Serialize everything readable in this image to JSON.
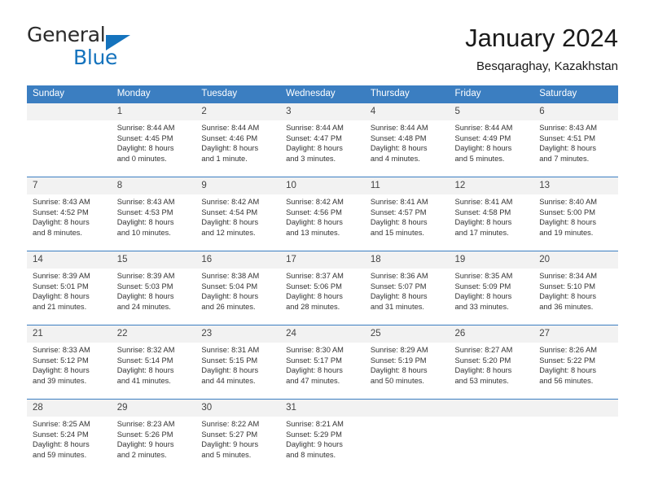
{
  "brand": {
    "name_part1": "General",
    "name_part2": "Blue"
  },
  "header": {
    "title": "January 2024",
    "location": "Besqaraghay, Kazakhstan"
  },
  "calendar": {
    "weekday_headers": [
      "Sunday",
      "Monday",
      "Tuesday",
      "Wednesday",
      "Thursday",
      "Friday",
      "Saturday"
    ],
    "colors": {
      "header_blue": "#3b7ec1",
      "daynum_band": "#f2f2f2",
      "brand_blue": "#1573bd"
    },
    "weeks": [
      [
        {
          "day": "",
          "sunrise": "",
          "sunset": "",
          "daylight_line1": "",
          "daylight_line2": ""
        },
        {
          "day": "1",
          "sunrise": "Sunrise: 8:44 AM",
          "sunset": "Sunset: 4:45 PM",
          "daylight_line1": "Daylight: 8 hours",
          "daylight_line2": "and 0 minutes."
        },
        {
          "day": "2",
          "sunrise": "Sunrise: 8:44 AM",
          "sunset": "Sunset: 4:46 PM",
          "daylight_line1": "Daylight: 8 hours",
          "daylight_line2": "and 1 minute."
        },
        {
          "day": "3",
          "sunrise": "Sunrise: 8:44 AM",
          "sunset": "Sunset: 4:47 PM",
          "daylight_line1": "Daylight: 8 hours",
          "daylight_line2": "and 3 minutes."
        },
        {
          "day": "4",
          "sunrise": "Sunrise: 8:44 AM",
          "sunset": "Sunset: 4:48 PM",
          "daylight_line1": "Daylight: 8 hours",
          "daylight_line2": "and 4 minutes."
        },
        {
          "day": "5",
          "sunrise": "Sunrise: 8:44 AM",
          "sunset": "Sunset: 4:49 PM",
          "daylight_line1": "Daylight: 8 hours",
          "daylight_line2": "and 5 minutes."
        },
        {
          "day": "6",
          "sunrise": "Sunrise: 8:43 AM",
          "sunset": "Sunset: 4:51 PM",
          "daylight_line1": "Daylight: 8 hours",
          "daylight_line2": "and 7 minutes."
        }
      ],
      [
        {
          "day": "7",
          "sunrise": "Sunrise: 8:43 AM",
          "sunset": "Sunset: 4:52 PM",
          "daylight_line1": "Daylight: 8 hours",
          "daylight_line2": "and 8 minutes."
        },
        {
          "day": "8",
          "sunrise": "Sunrise: 8:43 AM",
          "sunset": "Sunset: 4:53 PM",
          "daylight_line1": "Daylight: 8 hours",
          "daylight_line2": "and 10 minutes."
        },
        {
          "day": "9",
          "sunrise": "Sunrise: 8:42 AM",
          "sunset": "Sunset: 4:54 PM",
          "daylight_line1": "Daylight: 8 hours",
          "daylight_line2": "and 12 minutes."
        },
        {
          "day": "10",
          "sunrise": "Sunrise: 8:42 AM",
          "sunset": "Sunset: 4:56 PM",
          "daylight_line1": "Daylight: 8 hours",
          "daylight_line2": "and 13 minutes."
        },
        {
          "day": "11",
          "sunrise": "Sunrise: 8:41 AM",
          "sunset": "Sunset: 4:57 PM",
          "daylight_line1": "Daylight: 8 hours",
          "daylight_line2": "and 15 minutes."
        },
        {
          "day": "12",
          "sunrise": "Sunrise: 8:41 AM",
          "sunset": "Sunset: 4:58 PM",
          "daylight_line1": "Daylight: 8 hours",
          "daylight_line2": "and 17 minutes."
        },
        {
          "day": "13",
          "sunrise": "Sunrise: 8:40 AM",
          "sunset": "Sunset: 5:00 PM",
          "daylight_line1": "Daylight: 8 hours",
          "daylight_line2": "and 19 minutes."
        }
      ],
      [
        {
          "day": "14",
          "sunrise": "Sunrise: 8:39 AM",
          "sunset": "Sunset: 5:01 PM",
          "daylight_line1": "Daylight: 8 hours",
          "daylight_line2": "and 21 minutes."
        },
        {
          "day": "15",
          "sunrise": "Sunrise: 8:39 AM",
          "sunset": "Sunset: 5:03 PM",
          "daylight_line1": "Daylight: 8 hours",
          "daylight_line2": "and 24 minutes."
        },
        {
          "day": "16",
          "sunrise": "Sunrise: 8:38 AM",
          "sunset": "Sunset: 5:04 PM",
          "daylight_line1": "Daylight: 8 hours",
          "daylight_line2": "and 26 minutes."
        },
        {
          "day": "17",
          "sunrise": "Sunrise: 8:37 AM",
          "sunset": "Sunset: 5:06 PM",
          "daylight_line1": "Daylight: 8 hours",
          "daylight_line2": "and 28 minutes."
        },
        {
          "day": "18",
          "sunrise": "Sunrise: 8:36 AM",
          "sunset": "Sunset: 5:07 PM",
          "daylight_line1": "Daylight: 8 hours",
          "daylight_line2": "and 31 minutes."
        },
        {
          "day": "19",
          "sunrise": "Sunrise: 8:35 AM",
          "sunset": "Sunset: 5:09 PM",
          "daylight_line1": "Daylight: 8 hours",
          "daylight_line2": "and 33 minutes."
        },
        {
          "day": "20",
          "sunrise": "Sunrise: 8:34 AM",
          "sunset": "Sunset: 5:10 PM",
          "daylight_line1": "Daylight: 8 hours",
          "daylight_line2": "and 36 minutes."
        }
      ],
      [
        {
          "day": "21",
          "sunrise": "Sunrise: 8:33 AM",
          "sunset": "Sunset: 5:12 PM",
          "daylight_line1": "Daylight: 8 hours",
          "daylight_line2": "and 39 minutes."
        },
        {
          "day": "22",
          "sunrise": "Sunrise: 8:32 AM",
          "sunset": "Sunset: 5:14 PM",
          "daylight_line1": "Daylight: 8 hours",
          "daylight_line2": "and 41 minutes."
        },
        {
          "day": "23",
          "sunrise": "Sunrise: 8:31 AM",
          "sunset": "Sunset: 5:15 PM",
          "daylight_line1": "Daylight: 8 hours",
          "daylight_line2": "and 44 minutes."
        },
        {
          "day": "24",
          "sunrise": "Sunrise: 8:30 AM",
          "sunset": "Sunset: 5:17 PM",
          "daylight_line1": "Daylight: 8 hours",
          "daylight_line2": "and 47 minutes."
        },
        {
          "day": "25",
          "sunrise": "Sunrise: 8:29 AM",
          "sunset": "Sunset: 5:19 PM",
          "daylight_line1": "Daylight: 8 hours",
          "daylight_line2": "and 50 minutes."
        },
        {
          "day": "26",
          "sunrise": "Sunrise: 8:27 AM",
          "sunset": "Sunset: 5:20 PM",
          "daylight_line1": "Daylight: 8 hours",
          "daylight_line2": "and 53 minutes."
        },
        {
          "day": "27",
          "sunrise": "Sunrise: 8:26 AM",
          "sunset": "Sunset: 5:22 PM",
          "daylight_line1": "Daylight: 8 hours",
          "daylight_line2": "and 56 minutes."
        }
      ],
      [
        {
          "day": "28",
          "sunrise": "Sunrise: 8:25 AM",
          "sunset": "Sunset: 5:24 PM",
          "daylight_line1": "Daylight: 8 hours",
          "daylight_line2": "and 59 minutes."
        },
        {
          "day": "29",
          "sunrise": "Sunrise: 8:23 AM",
          "sunset": "Sunset: 5:26 PM",
          "daylight_line1": "Daylight: 9 hours",
          "daylight_line2": "and 2 minutes."
        },
        {
          "day": "30",
          "sunrise": "Sunrise: 8:22 AM",
          "sunset": "Sunset: 5:27 PM",
          "daylight_line1": "Daylight: 9 hours",
          "daylight_line2": "and 5 minutes."
        },
        {
          "day": "31",
          "sunrise": "Sunrise: 8:21 AM",
          "sunset": "Sunset: 5:29 PM",
          "daylight_line1": "Daylight: 9 hours",
          "daylight_line2": "and 8 minutes."
        },
        {
          "day": "",
          "sunrise": "",
          "sunset": "",
          "daylight_line1": "",
          "daylight_line2": ""
        },
        {
          "day": "",
          "sunrise": "",
          "sunset": "",
          "daylight_line1": "",
          "daylight_line2": ""
        },
        {
          "day": "",
          "sunrise": "",
          "sunset": "",
          "daylight_line1": "",
          "daylight_line2": ""
        }
      ]
    ]
  }
}
